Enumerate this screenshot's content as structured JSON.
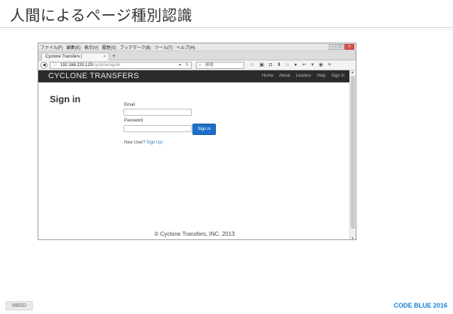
{
  "slide": {
    "title": "人間によるページ種別認識",
    "footer_left": "MBSD",
    "footer_right": "CODE BLUE 2016"
  },
  "browser": {
    "menu": [
      "ファイル(F)",
      "編集(E)",
      "表示(V)",
      "履歴(S)",
      "ブックマーク(B)",
      "ツール(T)",
      "ヘルプ(H)"
    ],
    "tab_title": "Cyclone Transfers |",
    "url_host": "192.168.220.129",
    "url_path": "/cyclone/signin",
    "search_placeholder": "検索"
  },
  "site": {
    "brand": "CYCLONE TRANSFERS",
    "nav": [
      "Home",
      "About",
      "Leaders",
      "Help",
      "Sign in"
    ],
    "signin_heading": "Sign in",
    "email_label": "Email",
    "password_label": "Password",
    "signin_button": "Sign in",
    "new_user_text": "New User?",
    "signup_link": "Sign Up!",
    "footer": "© Cyclone Transfers, INC. 2013"
  }
}
